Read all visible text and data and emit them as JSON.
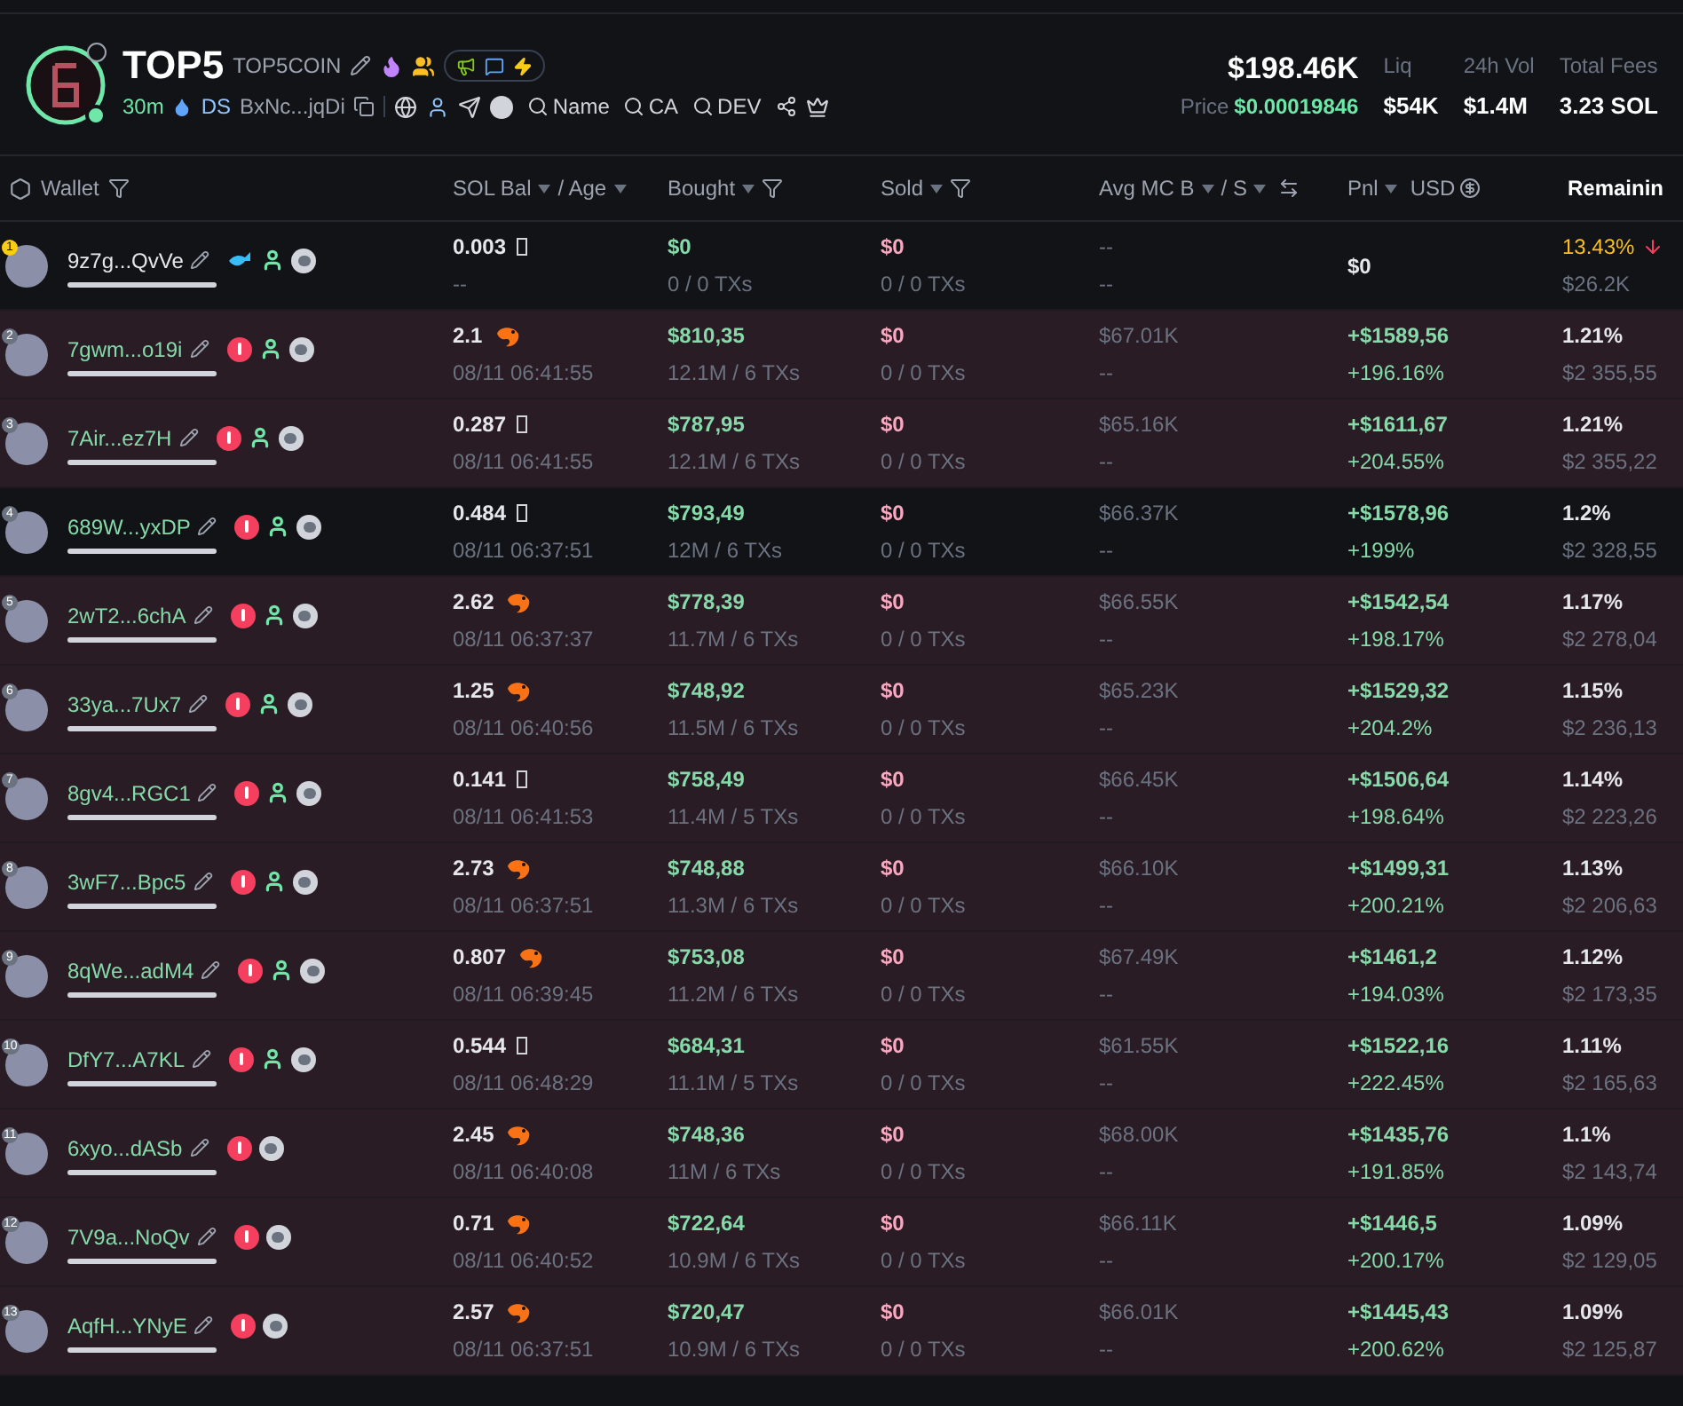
{
  "token": {
    "symbol": "TOP5",
    "name": "TOP5COIN",
    "age": "30m",
    "dex": "DS",
    "address": "BxNc...jqDi",
    "searches": [
      {
        "label": "Name"
      },
      {
        "label": "CA"
      },
      {
        "label": "DEV"
      }
    ],
    "market_cap": "$198.46K",
    "price_label": "Price",
    "price": "$0.00019846",
    "stats": [
      {
        "label": "Liq",
        "value": "$54K"
      },
      {
        "label": "24h Vol",
        "value": "$1.4M"
      },
      {
        "label": "Total Fees",
        "value": "3.23 SOL"
      }
    ]
  },
  "columns": [
    {
      "kind": "wallet",
      "label": "Wallet"
    },
    {
      "kind": "dual",
      "label": "SOL Bal",
      "label2": "/ Age"
    },
    {
      "kind": "filter",
      "label": "Bought"
    },
    {
      "kind": "filter",
      "label": "Sold"
    },
    {
      "kind": "swap",
      "label": "Avg MC B",
      "label2": "/ S"
    },
    {
      "kind": "currency",
      "label": "Pnl",
      "label2": "USD"
    },
    {
      "kind": "plain",
      "label": "Remainin"
    }
  ],
  "rows": [
    {
      "rank": "1",
      "top": true,
      "highlighted": false,
      "wallet": "9z7g...QvVe",
      "tags": [
        {
          "kind": "whale"
        },
        {
          "kind": "person"
        },
        {
          "kind": "coin"
        }
      ],
      "bal": {
        "value": "0.003",
        "kind": "box"
      },
      "age": "--",
      "bought": "$0",
      "bought_sub": "0 / 0 TXs",
      "sold": "$0",
      "sold_sub": "0 / 0 TXs",
      "avg_b": "--",
      "avg_s": "--",
      "pnl": "$0",
      "remaining": "13.43%",
      "remaining_usd": "$26.2K"
    },
    {
      "rank": "2",
      "top": false,
      "highlighted": true,
      "wallet": "7gwm...o19i",
      "tags": [
        {
          "kind": "alert"
        },
        {
          "kind": "person"
        },
        {
          "kind": "coin"
        }
      ],
      "bal": {
        "value": "2.1",
        "kind": "shrimp"
      },
      "age": "08/11 06:41:55",
      "bought": "$810,35",
      "bought_sub": "12.1M / 6 TXs",
      "sold": "$0",
      "sold_sub": "0 / 0 TXs",
      "avg_b": "$67.01K",
      "avg_s": "--",
      "pnl": "+$1589,56",
      "pnl_pct": "+196.16%",
      "remaining": "1.21%",
      "remaining_usd": "$2 355,55"
    },
    {
      "rank": "3",
      "top": false,
      "highlighted": true,
      "wallet": "7Air...ez7H",
      "tags": [
        {
          "kind": "alert"
        },
        {
          "kind": "person"
        },
        {
          "kind": "coin"
        }
      ],
      "bal": {
        "value": "0.287",
        "kind": "box"
      },
      "age": "08/11 06:41:55",
      "bought": "$787,95",
      "bought_sub": "12.1M / 6 TXs",
      "sold": "$0",
      "sold_sub": "0 / 0 TXs",
      "avg_b": "$65.16K",
      "avg_s": "--",
      "pnl": "+$1611,67",
      "pnl_pct": "+204.55%",
      "remaining": "1.21%",
      "remaining_usd": "$2 355,22"
    },
    {
      "rank": "4",
      "top": false,
      "highlighted": false,
      "wallet": "689W...yxDP",
      "tags": [
        {
          "kind": "alert"
        },
        {
          "kind": "person"
        },
        {
          "kind": "coin"
        }
      ],
      "bal": {
        "value": "0.484",
        "kind": "box"
      },
      "age": "08/11 06:37:51",
      "bought": "$793,49",
      "bought_sub": "12M / 6 TXs",
      "sold": "$0",
      "sold_sub": "0 / 0 TXs",
      "avg_b": "$66.37K",
      "avg_s": "--",
      "pnl": "+$1578,96",
      "pnl_pct": "+199%",
      "remaining": "1.2%",
      "remaining_usd": "$2 328,55"
    },
    {
      "rank": "5",
      "top": false,
      "highlighted": true,
      "wallet": "2wT2...6chA",
      "tags": [
        {
          "kind": "alert"
        },
        {
          "kind": "person"
        },
        {
          "kind": "coin"
        }
      ],
      "bal": {
        "value": "2.62",
        "kind": "shrimp"
      },
      "age": "08/11 06:37:37",
      "bought": "$778,39",
      "bought_sub": "11.7M / 6 TXs",
      "sold": "$0",
      "sold_sub": "0 / 0 TXs",
      "avg_b": "$66.55K",
      "avg_s": "--",
      "pnl": "+$1542,54",
      "pnl_pct": "+198.17%",
      "remaining": "1.17%",
      "remaining_usd": "$2 278,04"
    },
    {
      "rank": "6",
      "top": false,
      "highlighted": true,
      "wallet": "33ya...7Ux7",
      "tags": [
        {
          "kind": "alert"
        },
        {
          "kind": "person"
        },
        {
          "kind": "coin"
        }
      ],
      "bal": {
        "value": "1.25",
        "kind": "shrimp"
      },
      "age": "08/11 06:40:56",
      "bought": "$748,92",
      "bought_sub": "11.5M / 6 TXs",
      "sold": "$0",
      "sold_sub": "0 / 0 TXs",
      "avg_b": "$65.23K",
      "avg_s": "--",
      "pnl": "+$1529,32",
      "pnl_pct": "+204.2%",
      "remaining": "1.15%",
      "remaining_usd": "$2 236,13"
    },
    {
      "rank": "7",
      "top": false,
      "highlighted": true,
      "wallet": "8gv4...RGC1",
      "tags": [
        {
          "kind": "alert"
        },
        {
          "kind": "person"
        },
        {
          "kind": "coin"
        }
      ],
      "bal": {
        "value": "0.141",
        "kind": "box"
      },
      "age": "08/11 06:41:53",
      "bought": "$758,49",
      "bought_sub": "11.4M / 5 TXs",
      "sold": "$0",
      "sold_sub": "0 / 0 TXs",
      "avg_b": "$66.45K",
      "avg_s": "--",
      "pnl": "+$1506,64",
      "pnl_pct": "+198.64%",
      "remaining": "1.14%",
      "remaining_usd": "$2 223,26"
    },
    {
      "rank": "8",
      "top": false,
      "highlighted": true,
      "wallet": "3wF7...Bpc5",
      "tags": [
        {
          "kind": "alert"
        },
        {
          "kind": "person"
        },
        {
          "kind": "coin"
        }
      ],
      "bal": {
        "value": "2.73",
        "kind": "shrimp"
      },
      "age": "08/11 06:37:51",
      "bought": "$748,88",
      "bought_sub": "11.3M / 6 TXs",
      "sold": "$0",
      "sold_sub": "0 / 0 TXs",
      "avg_b": "$66.10K",
      "avg_s": "--",
      "pnl": "+$1499,31",
      "pnl_pct": "+200.21%",
      "remaining": "1.13%",
      "remaining_usd": "$2 206,63"
    },
    {
      "rank": "9",
      "top": false,
      "highlighted": true,
      "wallet": "8qWe...adM4",
      "tags": [
        {
          "kind": "alert"
        },
        {
          "kind": "person"
        },
        {
          "kind": "coin"
        }
      ],
      "bal": {
        "value": "0.807",
        "kind": "shrimp"
      },
      "age": "08/11 06:39:45",
      "bought": "$753,08",
      "bought_sub": "11.2M / 6 TXs",
      "sold": "$0",
      "sold_sub": "0 / 0 TXs",
      "avg_b": "$67.49K",
      "avg_s": "--",
      "pnl": "+$1461,2",
      "pnl_pct": "+194.03%",
      "remaining": "1.12%",
      "remaining_usd": "$2 173,35"
    },
    {
      "rank": "10",
      "top": false,
      "highlighted": true,
      "wallet": "DfY7...A7KL",
      "tags": [
        {
          "kind": "alert"
        },
        {
          "kind": "person"
        },
        {
          "kind": "coin"
        }
      ],
      "bal": {
        "value": "0.544",
        "kind": "box"
      },
      "age": "08/11 06:48:29",
      "bought": "$684,31",
      "bought_sub": "11.1M / 5 TXs",
      "sold": "$0",
      "sold_sub": "0 / 0 TXs",
      "avg_b": "$61.55K",
      "avg_s": "--",
      "pnl": "+$1522,16",
      "pnl_pct": "+222.45%",
      "remaining": "1.11%",
      "remaining_usd": "$2 165,63"
    },
    {
      "rank": "11",
      "top": false,
      "highlighted": true,
      "wallet": "6xyo...dASb",
      "tags": [
        {
          "kind": "alert"
        },
        {
          "kind": "coin"
        }
      ],
      "bal": {
        "value": "2.45",
        "kind": "shrimp"
      },
      "age": "08/11 06:40:08",
      "bought": "$748,36",
      "bought_sub": "11M / 6 TXs",
      "sold": "$0",
      "sold_sub": "0 / 0 TXs",
      "avg_b": "$68.00K",
      "avg_s": "--",
      "pnl": "+$1435,76",
      "pnl_pct": "+191.85%",
      "remaining": "1.1%",
      "remaining_usd": "$2 143,74"
    },
    {
      "rank": "12",
      "top": false,
      "highlighted": true,
      "wallet": "7V9a...NoQv",
      "tags": [
        {
          "kind": "alert"
        },
        {
          "kind": "coin"
        }
      ],
      "bal": {
        "value": "0.71",
        "kind": "shrimp"
      },
      "age": "08/11 06:40:52",
      "bought": "$722,64",
      "bought_sub": "10.9M / 6 TXs",
      "sold": "$0",
      "sold_sub": "0 / 0 TXs",
      "avg_b": "$66.11K",
      "avg_s": "--",
      "pnl": "+$1446,5",
      "pnl_pct": "+200.17%",
      "remaining": "1.09%",
      "remaining_usd": "$2 129,05"
    },
    {
      "rank": "13",
      "top": false,
      "highlighted": true,
      "wallet": "AqfH...YNyE",
      "tags": [
        {
          "kind": "alert"
        },
        {
          "kind": "coin"
        }
      ],
      "bal": {
        "value": "2.57",
        "kind": "shrimp"
      },
      "age": "08/11 06:37:51",
      "bought": "$720,47",
      "bought_sub": "10.9M / 6 TXs",
      "sold": "$0",
      "sold_sub": "0 / 0 TXs",
      "avg_b": "$66.01K",
      "avg_s": "--",
      "pnl": "+$1445,43",
      "pnl_pct": "+200.62%",
      "remaining": "1.09%",
      "remaining_usd": "$2 125,87"
    }
  ]
}
